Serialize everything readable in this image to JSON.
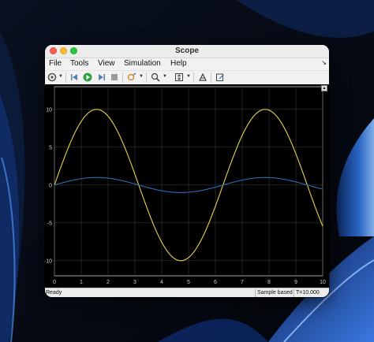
{
  "window": {
    "title": "Scope"
  },
  "menubar": {
    "items": [
      "File",
      "Tools",
      "View",
      "Simulation",
      "Help"
    ]
  },
  "toolbar": {
    "icons": [
      "settings-icon",
      "step-back-icon",
      "run-icon",
      "step-forward-icon",
      "stop-icon",
      "highlight-icon",
      "zoom-icon",
      "scale-axes-icon",
      "cursor-measure-icon",
      "edit-icon"
    ]
  },
  "statusbar": {
    "left": "Ready",
    "mode": "Sample based",
    "time": "T=10.000"
  },
  "chart_data": {
    "type": "line",
    "xlim": [
      0,
      10
    ],
    "ylim": [
      -12,
      13
    ],
    "x_ticks": [
      "0",
      "1",
      "2",
      "3",
      "4",
      "5",
      "6",
      "7",
      "8",
      "9",
      "10"
    ],
    "y_ticks": [
      "10",
      "5",
      "0",
      "-5",
      "-10"
    ],
    "grid": true,
    "series": [
      {
        "color": "#e6d24a",
        "function": "10*sin(x)",
        "x": [
          0,
          1.57,
          3.14,
          4.71,
          6.28,
          7.85,
          9.42,
          10
        ],
        "y": [
          0,
          10,
          0,
          -10,
          0,
          10,
          0,
          -5.4
        ]
      },
      {
        "color": "#2a6eb5",
        "function": "sin(x)",
        "x": [
          0,
          1.57,
          3.14,
          4.71,
          6.28,
          7.85,
          9.42,
          10
        ],
        "y": [
          0,
          1,
          0,
          -1,
          0,
          1,
          0,
          -0.54
        ]
      }
    ]
  },
  "colors": {
    "background": "#000000",
    "grid": "#3a3a3a",
    "axis": "#cfcfcf"
  }
}
